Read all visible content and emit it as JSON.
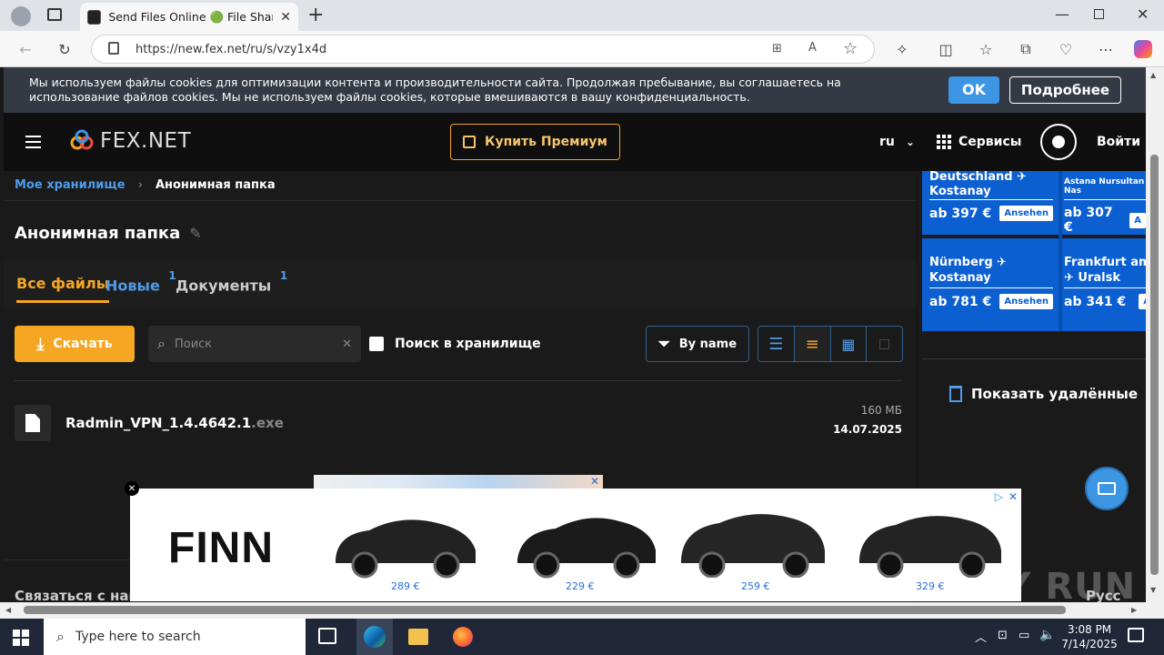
{
  "browser": {
    "tab_title": "Send Files Online 🟢 File Sharing",
    "url": "https://new.fex.net/ru/s/vzy1x4d"
  },
  "cookie": {
    "text": "Мы используем файлы cookies для оптимизации контента и производительности сайта. Продолжая пребывание, вы соглашаетесь на использование файлов cookies. Мы не используем файлы cookies, которые вмешиваются в вашу конфиденциальность.",
    "ok": "OK",
    "more": "Подробнее"
  },
  "header": {
    "logo": "FEX.NET",
    "premium": "Купить Премиум",
    "lang": "ru",
    "services": "Сервисы",
    "login": "Войти"
  },
  "breadcrumb": {
    "root": "Мое хранилище",
    "current": "Анонимная папка"
  },
  "folder": {
    "title": "Анонимная папка"
  },
  "tabs": [
    {
      "label": "Все файлы",
      "count": ""
    },
    {
      "label": "Новые",
      "count": "1"
    },
    {
      "label": "Документы",
      "count": "1"
    }
  ],
  "toolbar": {
    "download": "Скачать",
    "search_placeholder": "Поиск",
    "search_storage": "Поиск в хранилище",
    "sort": "By name"
  },
  "file": {
    "name": "Radmin_VPN_1.4.4642.1",
    "ext": ".exe",
    "size": "160 МБ",
    "date": "14.07.2025"
  },
  "sidebar": {
    "deleted": "Показать удалённые"
  },
  "ad_flights": [
    {
      "route": "Deutschland ✈ Kostanay",
      "price": "ab 397 €",
      "cta": "Ansehen"
    },
    {
      "route": "Astana Nursultan Nas",
      "price": "ab 307 €",
      "cta": "A"
    },
    {
      "route": "Nürnberg ✈ Kostanay",
      "price": "ab 781 €",
      "cta": "Ansehen"
    },
    {
      "route": "Frankfurt am ✈ Uralsk",
      "price": "ab 341 €",
      "cta": "A"
    }
  ],
  "ad_bottom": {
    "brand": "FINN",
    "prices": [
      "289 €",
      "229 €",
      "259 €",
      "329 €"
    ]
  },
  "footer": {
    "contact": "Связаться с нам",
    "lang": "Русс"
  },
  "taskbar": {
    "search": "Type here to search",
    "time": "3:08 PM",
    "date": "7/14/2025"
  },
  "watermark": "ANY RUN"
}
